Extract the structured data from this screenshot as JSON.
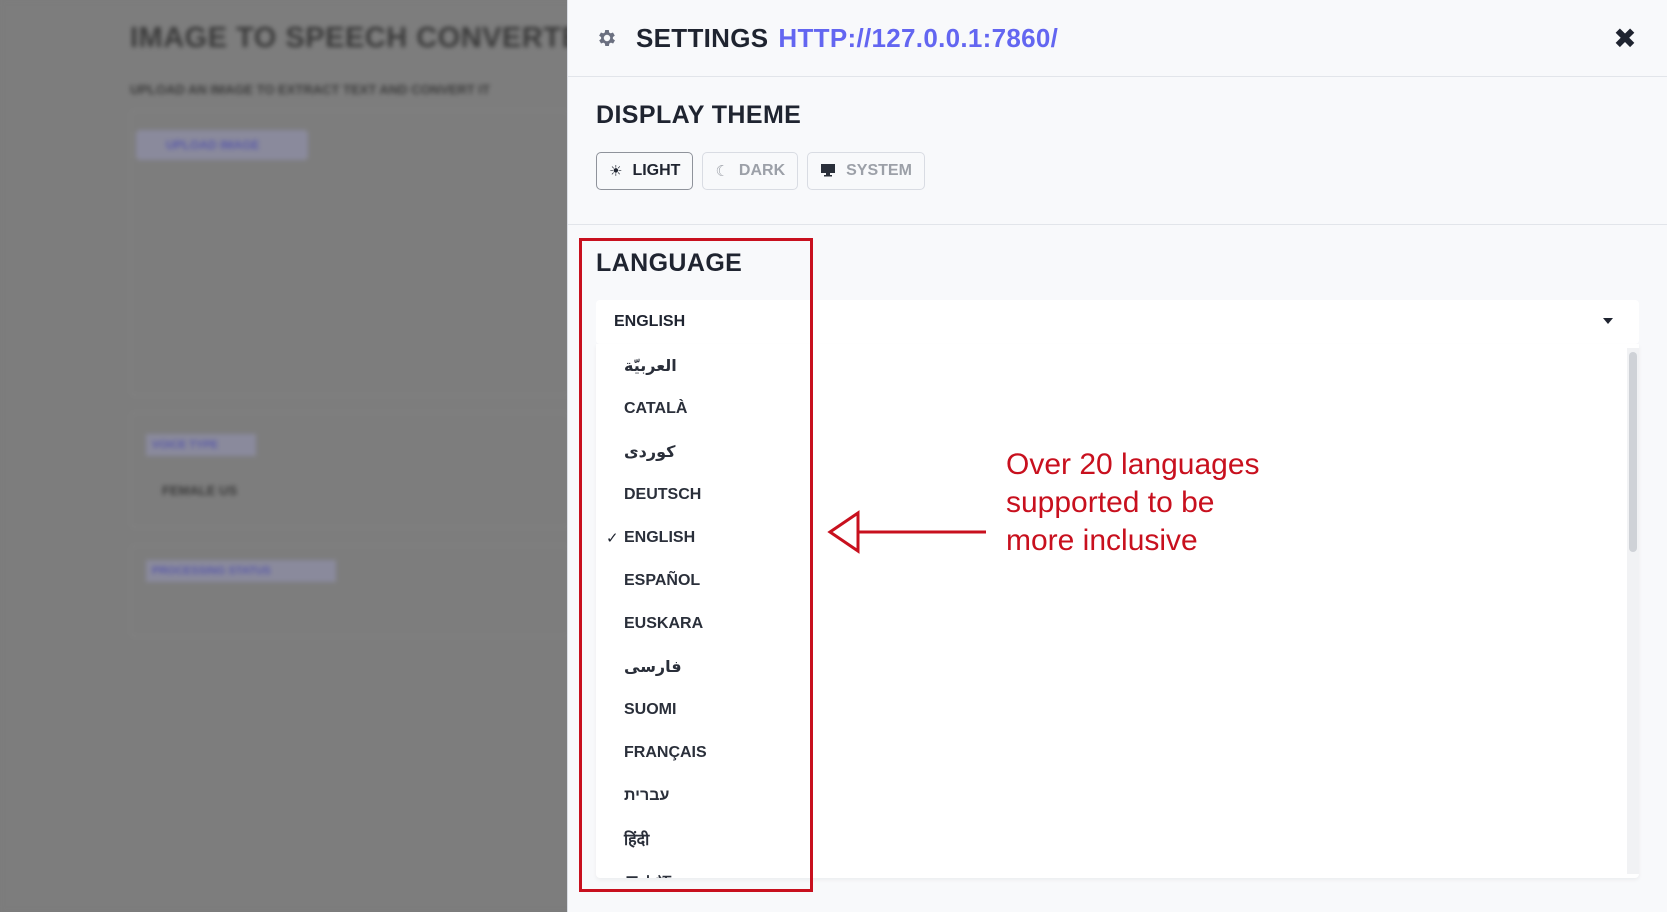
{
  "background": {
    "title": "IMAGE TO SPEECH CONVERTER",
    "subtitle": "UPLOAD AN IMAGE TO EXTRACT TEXT AND CONVERT IT",
    "upload_label": "UPLOAD IMAGE",
    "voice_type_label": "VOICE TYPE",
    "voice_type_value": "FEMALE US",
    "processing_status_label": "PROCESSING STATUS"
  },
  "modal": {
    "title": "SETTINGS",
    "url": "HTTP://127.0.0.1:7860/",
    "close_icon": "close-icon",
    "theme": {
      "heading": "DISPLAY THEME",
      "options": [
        {
          "label": "LIGHT",
          "icon": "sun-icon",
          "selected": true
        },
        {
          "label": "DARK",
          "icon": "moon-icon",
          "selected": false
        },
        {
          "label": "SYSTEM",
          "icon": "monitor-icon",
          "selected": false
        }
      ]
    },
    "language": {
      "heading": "LANGUAGE",
      "selected": "ENGLISH",
      "options": [
        "العربيّة",
        "CATALÀ",
        "کوردی",
        "DEUTSCH",
        "ENGLISH",
        "ESPAÑOL",
        "EUSKARA",
        "فارسی",
        "SUOMI",
        "FRANÇAIS",
        "עברית",
        "हिंदी",
        "日本語"
      ]
    }
  },
  "annotation": {
    "text": "Over 20 languages supported to be more inclusive",
    "color": "#c8101e"
  },
  "colors": {
    "accent": "#6366f1",
    "annotation": "#c8101e",
    "text": "#1f2430"
  }
}
